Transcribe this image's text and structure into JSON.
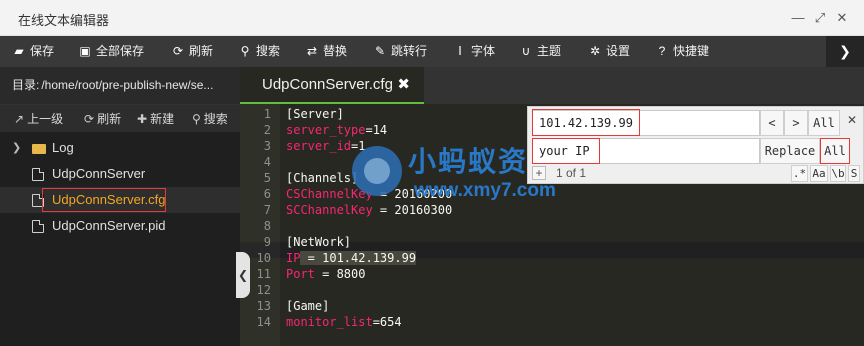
{
  "window": {
    "title": "在线文本编辑器",
    "controls": {
      "minimize": "—",
      "restore": "⤢",
      "close": "✕"
    }
  },
  "toolbar": {
    "items": [
      {
        "label": "保存",
        "icon": "save-icon",
        "glyph": "▰"
      },
      {
        "label": "全部保存",
        "icon": "save-all-icon",
        "glyph": "▣"
      },
      {
        "label": "刷新",
        "icon": "refresh-icon",
        "glyph": "⟳"
      },
      {
        "label": "搜索",
        "icon": "search-icon",
        "glyph": "⚲"
      },
      {
        "label": "替换",
        "icon": "replace-icon",
        "glyph": "⇄"
      },
      {
        "label": "跳转行",
        "icon": "goto-line-icon",
        "glyph": "✎"
      },
      {
        "label": "字体",
        "icon": "font-icon",
        "glyph": "Ⅰ"
      },
      {
        "label": "主题",
        "icon": "theme-icon",
        "glyph": "∪"
      },
      {
        "label": "设置",
        "icon": "gear-icon",
        "glyph": "✲"
      },
      {
        "label": "快捷键",
        "icon": "shortcut-icon",
        "glyph": "?"
      }
    ],
    "expand_glyph": "❯"
  },
  "sidebar": {
    "dir_label": "目录:",
    "dir_path": "/home/root/pre-publish-new/se...",
    "actions": [
      {
        "label": "上一级",
        "icon": "up-arrow-icon",
        "glyph": "↗"
      },
      {
        "label": "刷新",
        "icon": "refresh-icon",
        "glyph": "⟳"
      },
      {
        "label": "新建",
        "icon": "plus-icon",
        "glyph": "✚"
      },
      {
        "label": "搜索",
        "icon": "search-icon",
        "glyph": "⚲"
      }
    ],
    "tree": [
      {
        "name": "Log",
        "type": "folder",
        "chevron": "❯"
      },
      {
        "name": "UdpConnServer",
        "type": "file"
      },
      {
        "name": "UdpConnServer.cfg",
        "type": "file",
        "selected": true
      },
      {
        "name": "UdpConnServer.pid",
        "type": "file"
      }
    ],
    "collapse_glyph": "❮"
  },
  "editor": {
    "tab_title": "UdpConnServer.cfg",
    "tab_close": "✖",
    "line_numbers": [
      "1",
      "2",
      "3",
      "4",
      "5",
      "6",
      "7",
      "8",
      "9",
      "10",
      "11",
      "12",
      "13",
      "14"
    ],
    "lines": [
      {
        "k": "[Server]",
        "v": ""
      },
      {
        "k": "server_type",
        "v": "=14"
      },
      {
        "k": "server_id",
        "v": "=1"
      },
      {
        "k": "",
        "v": ""
      },
      {
        "k": "[Channels]",
        "v": ""
      },
      {
        "k": "CSChannelKey",
        "v": " = 20160200"
      },
      {
        "k": "SCChannelKey",
        "v": " = 20160300"
      },
      {
        "k": "",
        "v": ""
      },
      {
        "k": "[NetWork]",
        "v": ""
      },
      {
        "k": "IP",
        "v": " = 101.42.139.99"
      },
      {
        "k": "Port",
        "v": " = 8800"
      },
      {
        "k": "",
        "v": ""
      },
      {
        "k": "[Game]",
        "v": ""
      },
      {
        "k": "monitor_list",
        "v": "=654"
      }
    ]
  },
  "search": {
    "find_value": "101.42.139.99",
    "replace_value": "your IP",
    "prev_glyph": "<",
    "next_glyph": ">",
    "all_label": "All",
    "replace_label": "Replace",
    "replace_all_label": "All",
    "toggle_glyph": "+",
    "match_count": "1 of 1",
    "close_glyph": "✕",
    "options": [
      ".*",
      "Aa",
      "\\b",
      "S"
    ]
  },
  "watermark": {
    "text": "小蚂蚁资源网",
    "url": "www.xmy7.com"
  }
}
